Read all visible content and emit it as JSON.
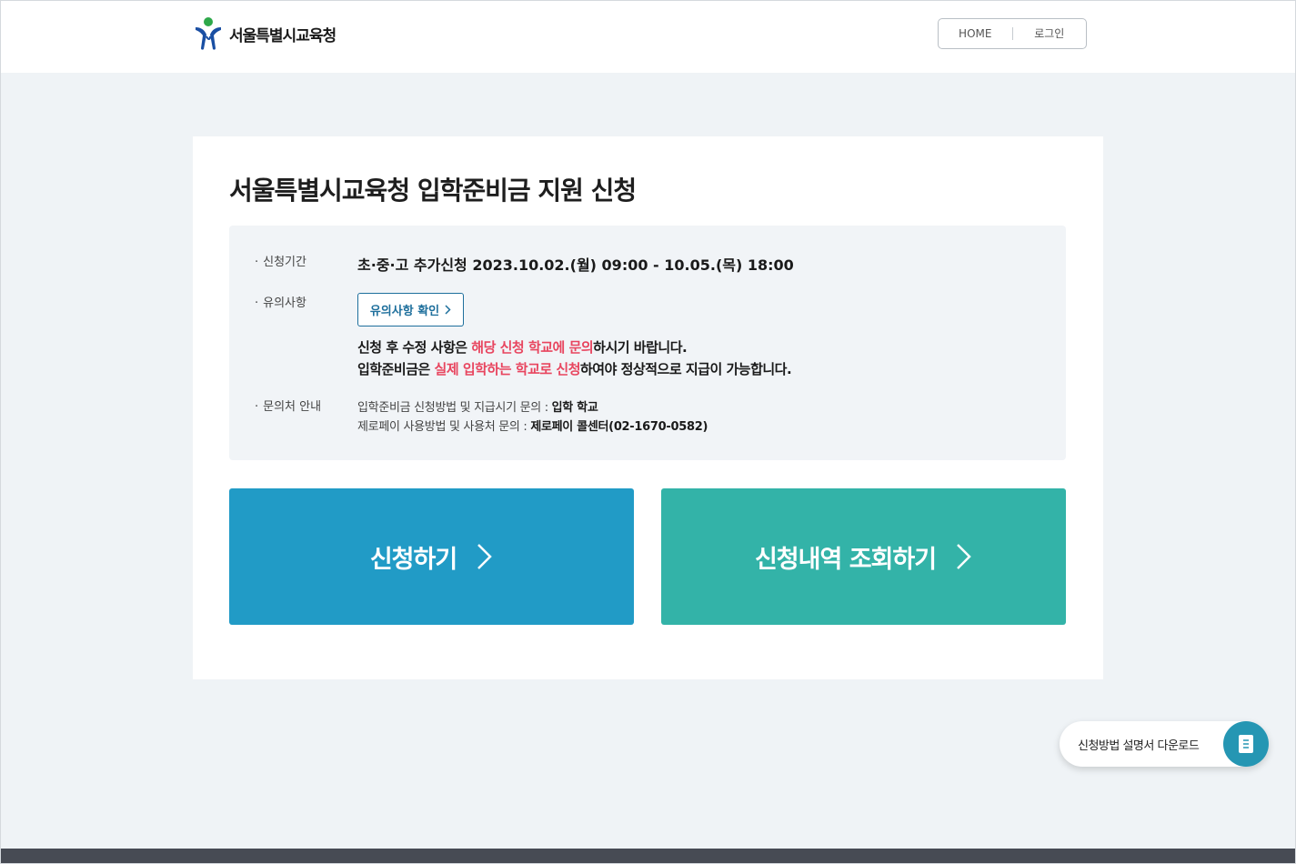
{
  "header": {
    "logo_text": "서울특별시교육청",
    "nav": {
      "home": "HOME",
      "login": "로그인"
    }
  },
  "main": {
    "title": "서울특별시교육청 입학준비금 지원 신청",
    "period": {
      "label": "신청기간",
      "value": "초·중·고 추가신청 2023.10.02.(월) 09:00 - 10.05.(목) 18:00"
    },
    "notice": {
      "label": "유의사항",
      "button_label": "유의사항 확인",
      "line1": {
        "a": "신청 후 수정 사항은 ",
        "hl": "해당 신청 학교에 문의",
        "b": "하시기 바랍니다."
      },
      "line2": {
        "a": "입학준비금은 ",
        "hl": "실제 입학하는 학교로 신청",
        "b": "하여야 정상적으로 지급이 가능합니다."
      }
    },
    "contact": {
      "label": "문의처 안내",
      "line1": {
        "text": "입학준비금 신청방법 및 지급시기 문의 : ",
        "strong": "입학 학교"
      },
      "line2": {
        "text": "제로페이 사용방법 및 사용처 문의 : ",
        "strong": "제로페이 콜센터(02-1670-0582)"
      }
    },
    "buttons": {
      "apply": "신청하기",
      "lookup": "신청내역 조회하기"
    }
  },
  "floating": {
    "download_label": "신청방법 설명서 다운로드",
    "icon": "document-icon"
  },
  "colors": {
    "apply": "#219bc6",
    "lookup": "#33b3a8",
    "highlight": "#e8455f",
    "notice_button": "#1e6f9c",
    "footer": "#474b54"
  }
}
